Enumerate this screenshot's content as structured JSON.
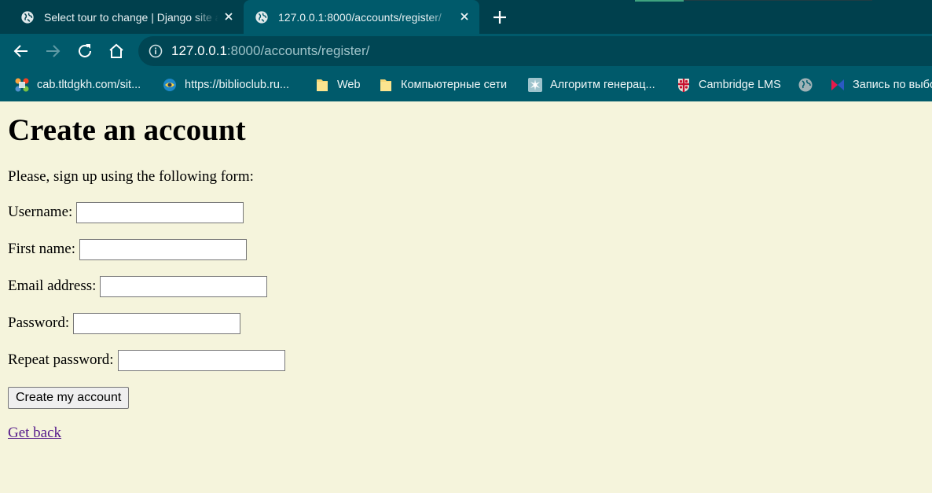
{
  "browser": {
    "tabs": [
      {
        "title": "Select tour to change | Django site admin",
        "active": false
      },
      {
        "title": "127.0.0.1:8000/accounts/register/",
        "active": true
      }
    ],
    "url_host": "127.0.0.1",
    "url_path": ":8000/accounts/register/",
    "bookmarks": [
      {
        "label": "cab.tltdgkh.com/sit...",
        "icon": "joomla-icon"
      },
      {
        "label": "https://biblioclub.ru...",
        "icon": "biblioclub-icon"
      },
      {
        "label": "Web",
        "icon": "folder-icon"
      },
      {
        "label": "Компьютерные сети",
        "icon": "folder-icon"
      },
      {
        "label": "Алгоритм генерац...",
        "icon": "site-icon"
      },
      {
        "label": "Cambridge LMS",
        "icon": "cambridge-icon"
      },
      {
        "label": "",
        "icon": "globe-icon"
      },
      {
        "label": "Запись по выбору",
        "icon": "bowtie-icon"
      }
    ]
  },
  "page": {
    "heading": "Create an account",
    "intro": "Please, sign up using the following form:",
    "fields": [
      {
        "label": "Username:",
        "value": ""
      },
      {
        "label": "First name:",
        "value": ""
      },
      {
        "label": "Email address:",
        "value": ""
      },
      {
        "label": "Password:",
        "value": ""
      },
      {
        "label": "Repeat password:",
        "value": ""
      }
    ],
    "submit_label": "Create my account",
    "back_link": "Get back"
  },
  "colors": {
    "page_background": "#f5f4dc",
    "chrome_tabstrip": "#00404d",
    "chrome_toolbar": "#005a6b",
    "link_visited": "#551a8b"
  }
}
